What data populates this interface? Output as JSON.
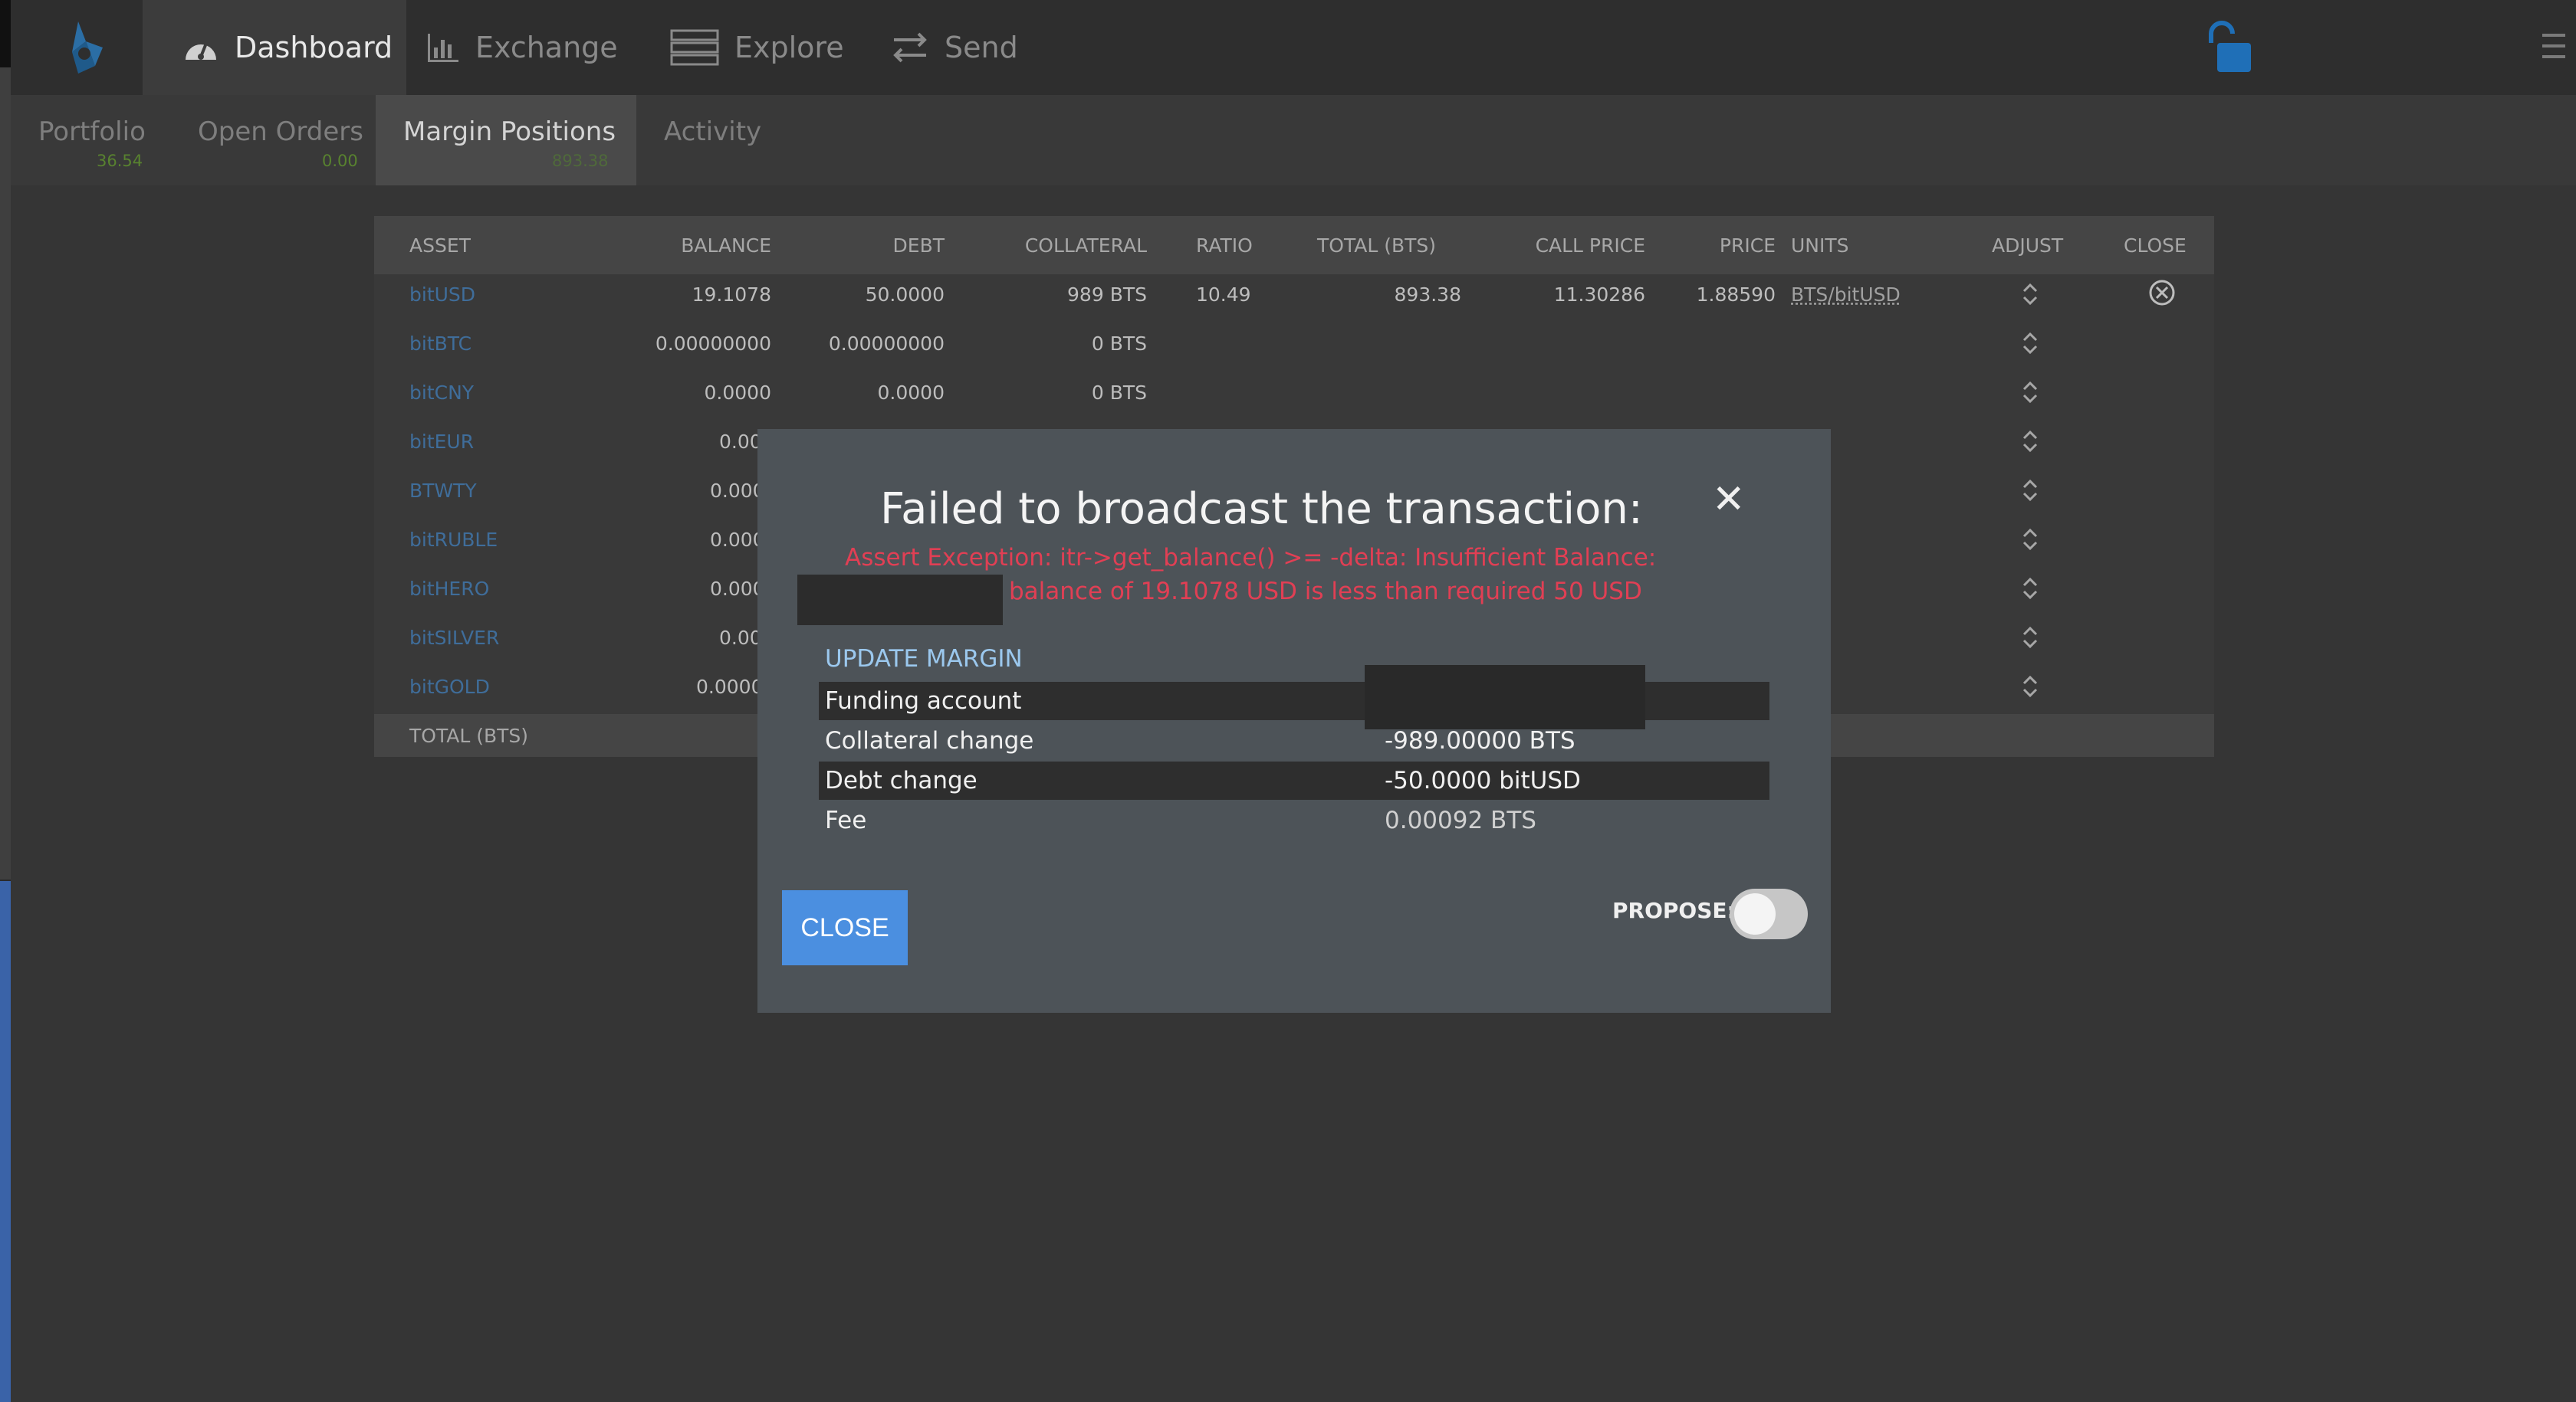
{
  "nav": {
    "items": [
      {
        "label": "Dashboard",
        "icon": "dashboard-icon",
        "active": true
      },
      {
        "label": "Exchange",
        "icon": "chart-icon",
        "active": false
      },
      {
        "label": "Explore",
        "icon": "server-icon",
        "active": false
      },
      {
        "label": "Send",
        "icon": "transfer-icon",
        "active": false
      }
    ],
    "icons": {
      "logo": "bitshares-logo",
      "lock": "unlock-icon",
      "menu": "hamburger-icon"
    }
  },
  "tabs": [
    {
      "label": "Portfolio",
      "amount": "36.54"
    },
    {
      "label": "Open Orders",
      "amount": "0.00"
    },
    {
      "label": "Margin Positions",
      "amount": "893.38",
      "active": true
    },
    {
      "label": "Activity",
      "amount": ""
    }
  ],
  "table": {
    "headers": [
      "ASSET",
      "BALANCE",
      "DEBT",
      "COLLATERAL",
      "RATIO",
      "TOTAL (BTS)",
      "CALL PRICE",
      "PRICE",
      "UNITS",
      "ADJUST",
      "CLOSE"
    ],
    "rows": [
      {
        "asset": "bitUSD",
        "balance": "19.1078",
        "debt": "50.0000",
        "collateral": "989 BTS",
        "ratio": "10.49",
        "total": "893.38",
        "call_price": "11.30286",
        "price": "1.88590",
        "units": "BTS/bitUSD"
      },
      {
        "asset": "bitBTC",
        "balance": "0.00000000",
        "debt": "0.00000000",
        "collateral": "0 BTS"
      },
      {
        "asset": "bitCNY",
        "balance": "0.0000",
        "debt": "0.0000",
        "collateral": "0 BTS"
      },
      {
        "asset": "bitEUR",
        "balance": "0.00"
      },
      {
        "asset": "BTWTY",
        "balance": "0.000"
      },
      {
        "asset": "bitRUBLE",
        "balance": "0.000"
      },
      {
        "asset": "bitHERO",
        "balance": "0.000"
      },
      {
        "asset": "bitSILVER",
        "balance": "0.00"
      },
      {
        "asset": "bitGOLD",
        "balance": "0.0000"
      }
    ],
    "footer_label": "TOTAL (BTS)"
  },
  "modal": {
    "title": "Failed to broadcast the transaction:",
    "error_line1": "Assert Exception: itr->get_balance() >= -delta: Insufficient Balance:",
    "error_line2": "balance of 19.1078 USD is less than required 50 USD",
    "operation_title": "UPDATE MARGIN",
    "fields": [
      {
        "key": "Funding account",
        "value": ""
      },
      {
        "key": "Collateral change",
        "value": "-989.00000 BTS"
      },
      {
        "key": "Debt change",
        "value": "-50.0000 bitUSD"
      },
      {
        "key": "Fee",
        "value": "0.00092 BTS"
      }
    ],
    "close_label": "CLOSE",
    "propose_label": "PROPOSE:",
    "propose_enabled": false
  },
  "colors": {
    "accent": "#4b8fe0",
    "error": "#e13f54",
    "link": "#3f6d9a",
    "positive": "#58822f"
  }
}
